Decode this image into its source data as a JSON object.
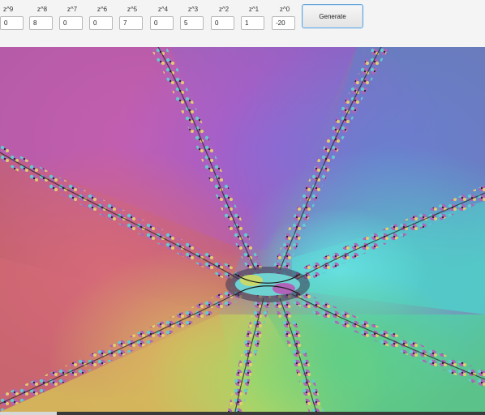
{
  "toolbar": {
    "coefficients": [
      {
        "label": "z^9",
        "value": "0"
      },
      {
        "label": "z^8",
        "value": "8"
      },
      {
        "label": "z^7",
        "value": "0"
      },
      {
        "label": "z^6",
        "value": "0"
      },
      {
        "label": "z^5",
        "value": "7"
      },
      {
        "label": "z^4",
        "value": "0"
      },
      {
        "label": "z^3",
        "value": "5"
      },
      {
        "label": "z^2",
        "value": "0"
      },
      {
        "label": "z^1",
        "value": "1"
      },
      {
        "label": "z^0",
        "value": "-20"
      }
    ],
    "generate_label": "Generate"
  },
  "canvas": {
    "image": "fractal-basins-of-attraction",
    "colors": {
      "top_left": "#b35aa6",
      "top": "#8f62c2",
      "top_right": "#6a7bbd",
      "left": "#c8656f",
      "center": "#6fd2d2",
      "right": "#55c4c4",
      "bottom_left": "#d3b25b",
      "bottom": "#a8d36b",
      "bottom_right": "#5bc28a"
    }
  }
}
